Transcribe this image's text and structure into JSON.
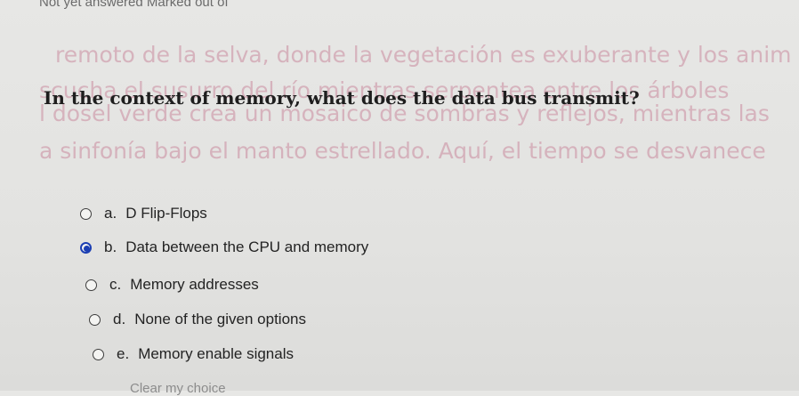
{
  "header": {
    "status_text": "Not yet answered     Marked out of"
  },
  "overlay": {
    "lines": [
      "remoto de la selva, donde la vegetación es exuberante y los anim",
      "scucha el susurro del río mientras serpentea entre los árboles",
      "l dosel verde crea un mosaico de sombras y reflejos, mientras las",
      "a sinfonía bajo el manto estrellado. Aquí, el tiempo se desvanece"
    ]
  },
  "question": {
    "text": "In the context of memory, what does the data bus transmit?"
  },
  "options": [
    {
      "letter": "a.",
      "label": "D Flip-Flops",
      "selected": false
    },
    {
      "letter": "b.",
      "label": "Data between the CPU and memory",
      "selected": true
    },
    {
      "letter": "c.",
      "label": "Memory addresses",
      "selected": false
    },
    {
      "letter": "d.",
      "label": "None of the given options",
      "selected": false
    },
    {
      "letter": "e.",
      "label": "Memory enable signals",
      "selected": false
    }
  ],
  "footer": {
    "clear_label": "Clear my choice"
  },
  "colors": {
    "radio_selected": "#1c3fb3",
    "overlay_text": "#c4768e"
  }
}
